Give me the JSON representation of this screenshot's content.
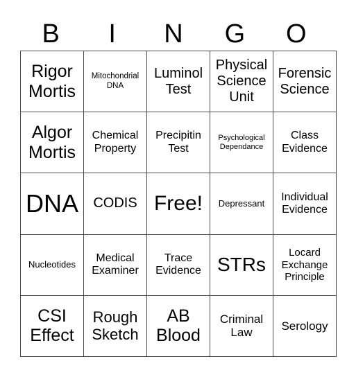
{
  "header": [
    "B",
    "I",
    "N",
    "G",
    "O"
  ],
  "rows": [
    [
      "Rigor Mortis",
      "Mitochondrial DNA",
      "Luminol Test",
      "Physical Science Unit",
      "Forensic Science"
    ],
    [
      "Algor Mortis",
      "Chemical Property",
      "Precipitin Test",
      "Psychological Dependance",
      "Class Evidence"
    ],
    [
      "DNA",
      "CODIS",
      "Free!",
      "Depressant",
      "Individual Evidence"
    ],
    [
      "Nucleotides",
      "Medical Examiner",
      "Trace Evidence",
      "STRs",
      "Locard Exchange Principle"
    ],
    [
      "CSI Effect",
      "Rough Sketch",
      "AB Blood",
      "Criminal Law",
      "Serology"
    ]
  ]
}
